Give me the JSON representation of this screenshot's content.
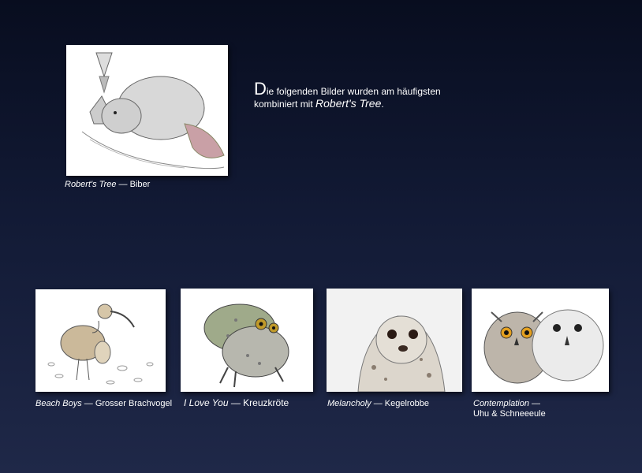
{
  "featured": {
    "title": "Robert's Tree",
    "separator": " — ",
    "subject": "Biber",
    "image_icon": "beaver-drawing"
  },
  "intro": {
    "dropcap": "D",
    "text_after_dropcap": "ie folgenden Bilder wurden am häufigsten",
    "line2_prefix": "kombiniert mit ",
    "line2_title": "Robert's Tree",
    "line2_suffix": "."
  },
  "gallery": [
    {
      "title": "Beach Boys",
      "separator": " — ",
      "subject": "Grosser Brachvogel",
      "image_icon": "curlew-drawing"
    },
    {
      "title": "I Love You",
      "separator": " — ",
      "subject": "Kreuzkröte",
      "image_icon": "toads-drawing"
    },
    {
      "title": "Melancholy",
      "separator": " — ",
      "subject": "Kegelrobbe",
      "image_icon": "seal-drawing"
    },
    {
      "title": "Contemplation",
      "separator": " —",
      "subject": "Uhu & Schneeeule",
      "image_icon": "owls-drawing"
    }
  ]
}
